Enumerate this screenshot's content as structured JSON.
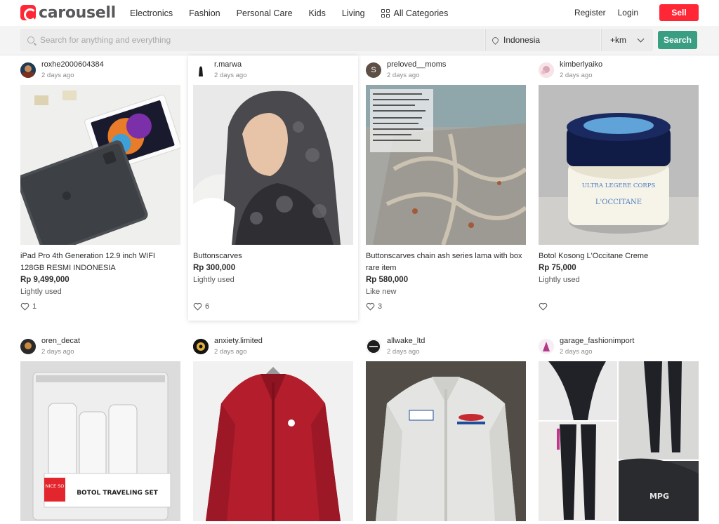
{
  "brand": {
    "name": "carousell"
  },
  "nav": {
    "items": [
      "Electronics",
      "Fashion",
      "Personal Care",
      "Kids",
      "Living"
    ],
    "all_categories": "All Categories"
  },
  "auth": {
    "register": "Register",
    "login": "Login",
    "sell": "Sell"
  },
  "search": {
    "placeholder": "Search for anything and everything",
    "location": "Indonesia",
    "distance": "+km",
    "button": "Search"
  },
  "colors": {
    "brand_red": "#ff2636",
    "search_green": "#3a9e83"
  },
  "listings": [
    {
      "seller": "roxhe2000604384",
      "time": "2 days ago",
      "title": "iPad Pro 4th Generation 12.9 inch WIFI 128GB RESMI INDONESIA",
      "price": "Rp 9,499,000",
      "condition": "Lightly used",
      "likes": "1"
    },
    {
      "seller": "r.marwa",
      "time": "2 days ago",
      "title": "Buttonscarves",
      "price": "Rp 300,000",
      "condition": "Lightly used",
      "likes": "6"
    },
    {
      "seller": "preloved__moms",
      "time": "2 days ago",
      "title": "Buttonscarves chain ash series lama with box rare item",
      "price": "Rp 580,000",
      "condition": "Like new",
      "likes": "3"
    },
    {
      "seller": "kimberlyaiko",
      "time": "2 days ago",
      "title": "Botol Kosong L'Occitane Creme",
      "price": "Rp 75,000",
      "condition": "Lightly used",
      "likes": ""
    },
    {
      "seller": "oren_decat",
      "time": "2 days ago"
    },
    {
      "seller": "anxiety.limited",
      "time": "2 days ago"
    },
    {
      "seller": "allwake_ltd",
      "time": "2 days ago"
    },
    {
      "seller": "garage_fashionimport",
      "time": "2 days ago"
    }
  ],
  "avatar_initial_3": "S",
  "photo_text": {
    "tag_brand": "NICE SO",
    "travel_set": "BOTOL TRAVELING SET",
    "jar_label": "ULTRA LEGERE CORPS",
    "jar_brand": "L'OCCITANE",
    "leggings_brand": "MPG"
  }
}
